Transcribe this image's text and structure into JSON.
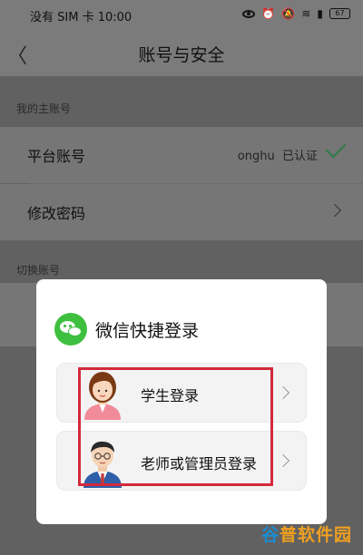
{
  "status_bar": {
    "carrier": "没有 SIM 卡",
    "time": "10:00",
    "battery": "67"
  },
  "header": {
    "title": "账号与安全"
  },
  "sections": {
    "main_account_label": "我的主账号",
    "switch_account_label": "切换账号"
  },
  "rows": {
    "platform_account": {
      "label": "平台账号",
      "value": "onghu",
      "status": "已认证"
    },
    "change_password": {
      "label": "修改密码"
    }
  },
  "dialog": {
    "title": "微信快捷登录",
    "options": [
      {
        "label": "学生登录"
      },
      {
        "label": "老师或管理员登录"
      }
    ]
  },
  "watermark": {
    "part1": "谷",
    "part2": "普软件园"
  },
  "colors": {
    "accent_green": "#2e7a48",
    "wechat_green": "#3fbf3f",
    "highlight_red": "#d22a3c"
  }
}
